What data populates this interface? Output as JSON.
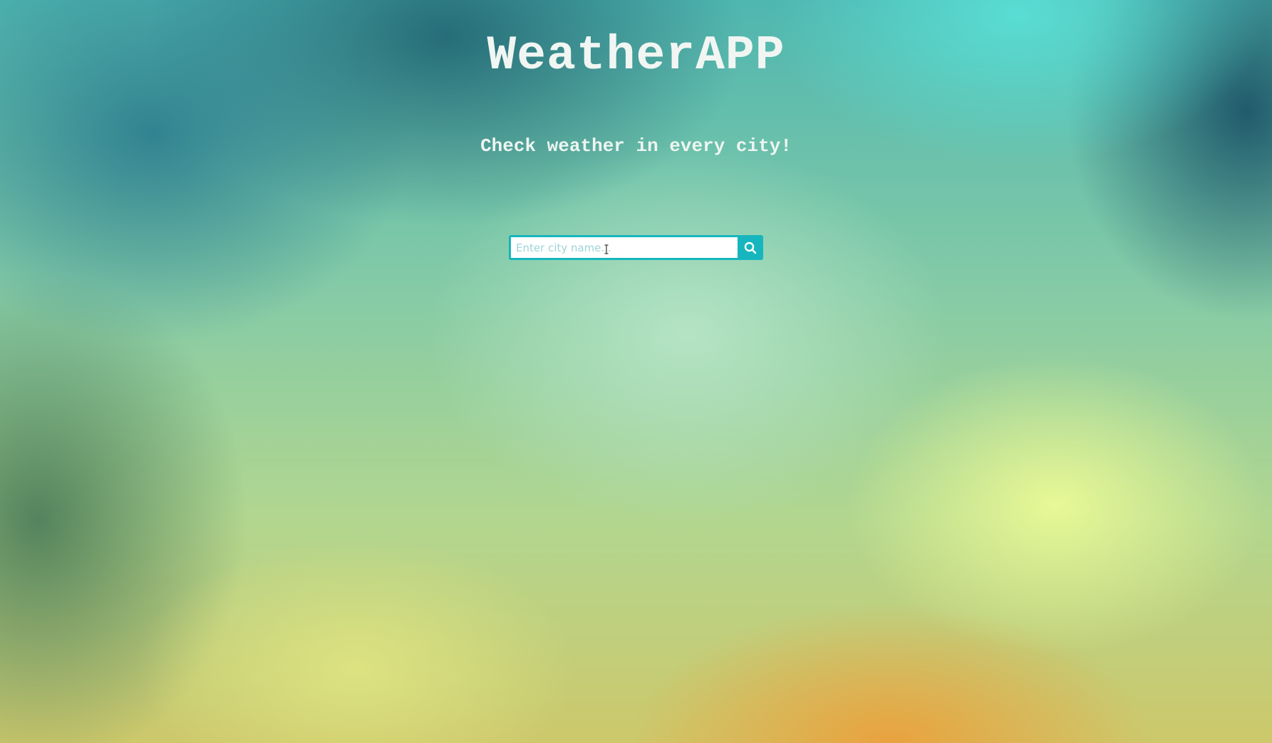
{
  "app": {
    "title": "WeatherAPP",
    "tagline": "Check weather in every city!"
  },
  "search": {
    "placeholder": "Enter city name...",
    "value": "",
    "button_icon": "search-icon"
  },
  "colors": {
    "accent": "#17b6be",
    "title_text": "#f1f6f3"
  }
}
